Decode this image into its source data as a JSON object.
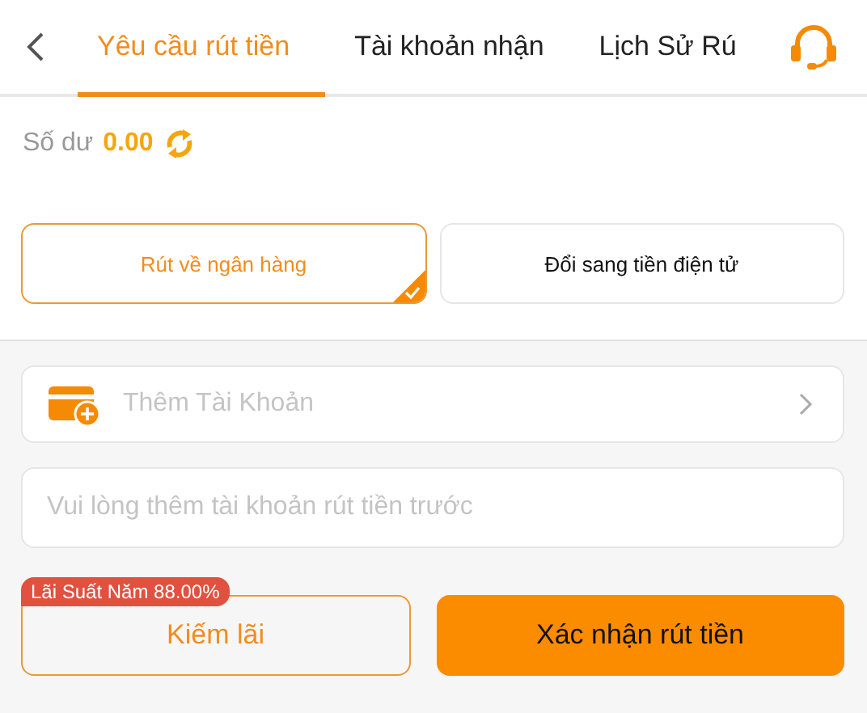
{
  "tabs": [
    {
      "label": "Yêu cầu rút tiền",
      "selected": true
    },
    {
      "label": "Tài khoản nhận",
      "selected": false
    },
    {
      "label": "Lịch Sử Rú",
      "selected": false
    }
  ],
  "balance": {
    "label": "Số dư",
    "amount": "0.00"
  },
  "methods": [
    {
      "label": "Rút về ngân hàng",
      "selected": true
    },
    {
      "label": "Đổi sang tiền điện tử",
      "selected": false
    }
  ],
  "account_row": {
    "label": "Thêm Tài Khoản"
  },
  "amount_field": {
    "placeholder": "Vui lòng thêm tài khoản rút tiền trước"
  },
  "earn_button": {
    "label": "Kiếm lãi",
    "badge": "Lãi Suất Năm 88.00%"
  },
  "confirm_button": {
    "label": "Xác nhận rút tiền"
  }
}
